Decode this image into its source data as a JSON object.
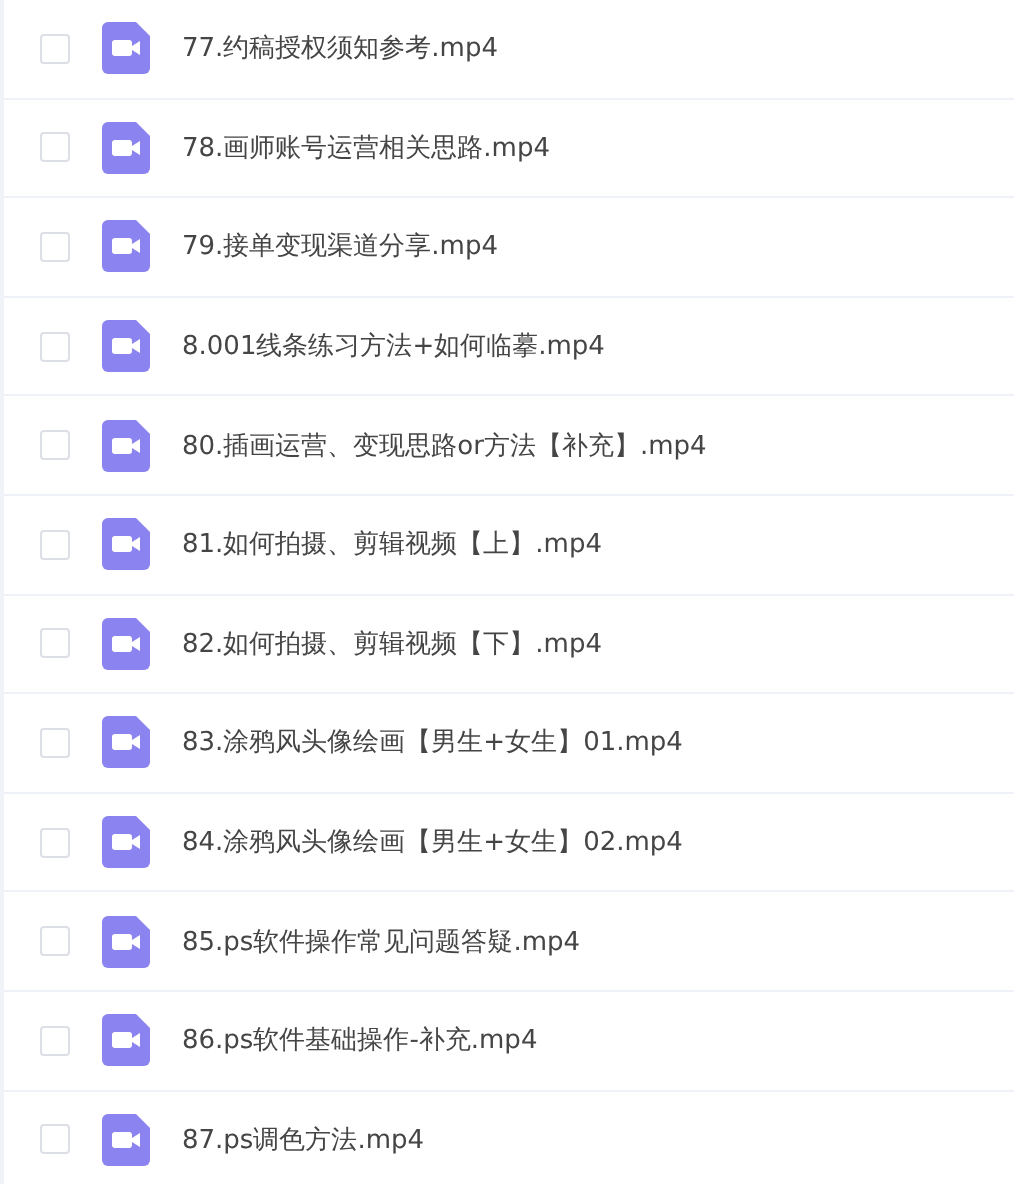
{
  "files": [
    {
      "name": "77.约稿授权须知参考.mp4",
      "checked": false
    },
    {
      "name": "78.画师账号运营相关思路.mp4",
      "checked": false
    },
    {
      "name": "79.接单变现渠道分享.mp4",
      "checked": false
    },
    {
      "name": "8.001线条练习方法+如何临摹.mp4",
      "checked": false
    },
    {
      "name": "80.插画运营、变现思路or方法【补充】.mp4",
      "checked": false
    },
    {
      "name": "81.如何拍摄、剪辑视频【上】.mp4",
      "checked": false
    },
    {
      "name": "82.如何拍摄、剪辑视频【下】.mp4",
      "checked": false
    },
    {
      "name": "83.涂鸦风头像绘画【男生+女生】01.mp4",
      "checked": false
    },
    {
      "name": "84.涂鸦风头像绘画【男生+女生】02.mp4",
      "checked": false
    },
    {
      "name": "85.ps软件操作常见问题答疑.mp4",
      "checked": false
    },
    {
      "name": "86.ps软件基础操作-补充.mp4",
      "checked": false
    },
    {
      "name": "87.ps调色方法.mp4",
      "checked": false
    }
  ]
}
